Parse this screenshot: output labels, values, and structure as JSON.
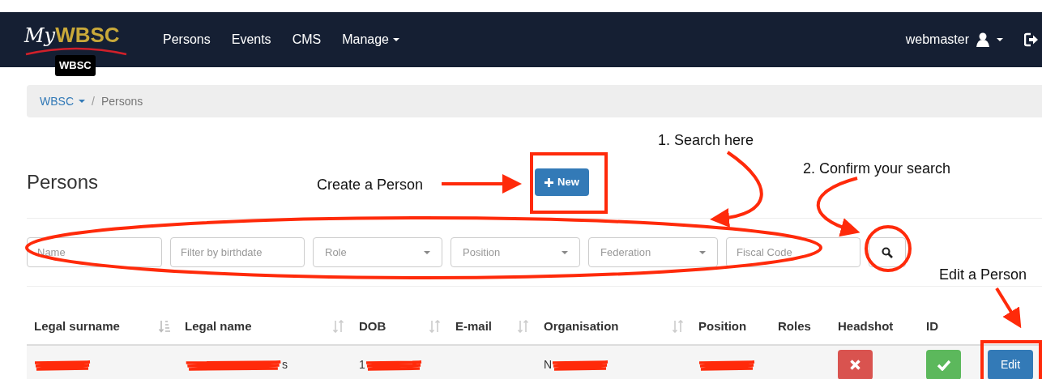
{
  "navbar": {
    "logo": {
      "prefix": "My",
      "name": "WBSC"
    },
    "tooltip": "WBSC",
    "items": [
      {
        "label": "Persons",
        "dropdown": false
      },
      {
        "label": "Events",
        "dropdown": false
      },
      {
        "label": "CMS",
        "dropdown": false
      },
      {
        "label": "Manage",
        "dropdown": true
      }
    ],
    "user": "webmaster"
  },
  "breadcrumb_separator": "/",
  "breadcrumb": [
    {
      "label": "WBSC",
      "dropdown": true,
      "active": false
    },
    {
      "label": "Persons",
      "dropdown": false,
      "active": true
    }
  ],
  "page_title": "Persons",
  "new_button": "New",
  "filters": [
    {
      "kind": "text",
      "placeholder": "Name"
    },
    {
      "kind": "text",
      "placeholder": "Filter by birthdate"
    },
    {
      "kind": "select",
      "placeholder": "Role"
    },
    {
      "kind": "select",
      "placeholder": "Position"
    },
    {
      "kind": "select",
      "placeholder": "Federation"
    },
    {
      "kind": "text",
      "placeholder": "Fiscal Code"
    }
  ],
  "table": {
    "columns": [
      {
        "label": "Legal surname",
        "sortable": true,
        "sorted": true
      },
      {
        "label": "Legal name",
        "sortable": true,
        "sorted": false
      },
      {
        "label": "DOB",
        "sortable": true,
        "sorted": false
      },
      {
        "label": "E-mail",
        "sortable": true,
        "sorted": false
      },
      {
        "label": "Organisation",
        "sortable": true,
        "sorted": false
      },
      {
        "label": "Position",
        "sortable": false
      },
      {
        "label": "Roles",
        "sortable": false
      },
      {
        "label": "Headshot",
        "sortable": false
      },
      {
        "label": "ID",
        "sortable": false
      }
    ],
    "rows": [
      {
        "cells": [
          {
            "kind": "redacted"
          },
          {
            "kind": "redacted",
            "tail": "s"
          },
          {
            "kind": "redacted",
            "head": "1"
          },
          {
            "kind": "empty"
          },
          {
            "kind": "redacted",
            "head": "N"
          },
          {
            "kind": "redacted"
          },
          {
            "kind": "empty"
          },
          {
            "kind": "flag",
            "ok": false
          },
          {
            "kind": "flag",
            "ok": true
          },
          {
            "kind": "button",
            "label": "Edit"
          }
        ]
      }
    ]
  },
  "annotations": [
    {
      "kind": "label",
      "text": "Create a Person"
    },
    {
      "kind": "label",
      "text": "1. Search here"
    },
    {
      "kind": "label",
      "text": "2. Confirm your search"
    },
    {
      "kind": "label",
      "text": "Edit a Person"
    }
  ]
}
